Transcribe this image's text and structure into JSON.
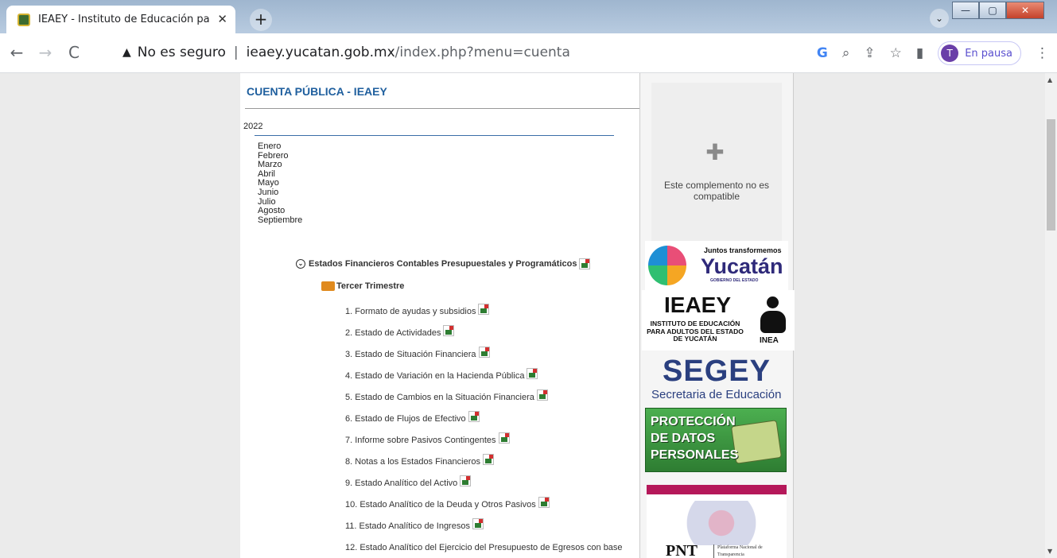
{
  "browser": {
    "tab_title": "IEAEY - Instituto de Educación pa",
    "tab_close": "✕",
    "new_tab": "+",
    "window_controls": {
      "minimize": "—",
      "maximize": "▢",
      "close": "✕"
    },
    "tab_search": "⌄",
    "back": "←",
    "forward": "→",
    "reload": "C",
    "security_icon": "▲",
    "security_text": "No es seguro",
    "address_separator": "|",
    "url_host": "ieaey.yucatan.gob.mx",
    "url_path": "/index.php?menu=cuenta",
    "toolbar_icons": {
      "google": "G",
      "zoom": "⌕",
      "share": "⇪",
      "bookmark": "☆",
      "sidepanel": "▮",
      "menu": "⋮"
    },
    "profile_initial": "T",
    "profile_label": "En pausa"
  },
  "page": {
    "title": "CUENTA PÚBLICA - IEAEY",
    "year": "2022",
    "months": [
      "Enero",
      "Febrero",
      "Marzo",
      "Abril",
      "Mayo",
      "Junio",
      "Julio",
      "Agosto",
      "Septiembre"
    ],
    "section_title": "Estados Financieros Contables Presupuestales y Programáticos",
    "trimester": "Tercer Trimestre",
    "items": [
      "1. Formato de ayudas y subsidios",
      "2. Estado de Actividades",
      "3. Estado de Situación Financiera",
      "4. Estado de Variación en la Hacienda Pública",
      "5. Estado de Cambios en la Situación Financiera",
      "6. Estado de Flujos de Efectivo",
      "7. Informe sobre Pasivos Contingentes",
      "8. Notas a los Estados Financieros",
      "9. Estado Analítico del Activo",
      "10. Estado Analítico de la Deuda y Otros Pasivos",
      "11. Estado Analítico de Ingresos",
      "12. Estado Analítico del Ejercicio del Presupuesto de Egresos con base"
    ]
  },
  "sidebar": {
    "plugin_text": "Este complemento no es compatible",
    "plugin_icon": "puzzle-icon",
    "logo_yucatan": {
      "line1": "Juntos transformemos",
      "line2": "Yucatán",
      "line3": "GOBIERNO DEL ESTADO"
    },
    "logo_ieaey": {
      "name": "IEAEY",
      "desc": "INSTITUTO DE EDUCACIÓN PARA ADULTOS DEL ESTADO DE YUCATÁN",
      "inea": "INEA"
    },
    "logo_segey": {
      "name": "SEGEY",
      "desc": "Secretaria de Educación"
    },
    "logo_datos": {
      "text": "PROTECCIÓN DE DATOS PERSONALES"
    },
    "logo_pnt": {
      "abbr": "PNT",
      "desc": "Plataforma Nacional de Transparencia"
    }
  },
  "colors": {
    "title_blue": "#1f5f9e",
    "underline_blue": "#3b6ea8",
    "page_bg": "#ebebeb"
  }
}
